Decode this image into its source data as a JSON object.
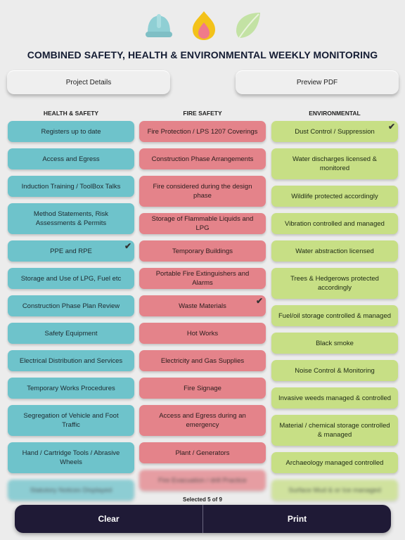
{
  "header": {
    "title": "COMBINED SAFETY, HEALTH & ENVIRONMENTAL WEEKLY MONITORING",
    "icons": [
      "hard-hat-icon",
      "flame-icon",
      "leaf-icon"
    ]
  },
  "top_buttons": {
    "project_details": "Project Details",
    "preview_pdf": "Preview PDF"
  },
  "columns": {
    "health_safety": {
      "heading": "HEALTH & SAFETY",
      "color": "#6ec3cb",
      "items": [
        {
          "label": "Registers up to date",
          "checked": false
        },
        {
          "label": "Access and Egress",
          "checked": false
        },
        {
          "label": "Induction Training / ToolBox Talks",
          "checked": false
        },
        {
          "label": "Method Statements, Risk Assessments & Permits",
          "checked": false
        },
        {
          "label": "PPE and RPE",
          "checked": true
        },
        {
          "label": "Storage and Use of LPG, Fuel etc",
          "checked": false
        },
        {
          "label": "Construction Phase Plan Review",
          "checked": false
        },
        {
          "label": "Safety Equipment",
          "checked": false
        },
        {
          "label": "Electrical Distribution and Services",
          "checked": false
        },
        {
          "label": "Temporary Works Procedures",
          "checked": false
        },
        {
          "label": "Segregation of Vehicle and Foot Traffic",
          "checked": false
        },
        {
          "label": "Hand / Cartridge Tools / Abrasive Wheels",
          "checked": false
        },
        {
          "label": "Statutory Notices Displayed",
          "checked": false
        }
      ]
    },
    "fire_safety": {
      "heading": "FIRE SAFETY",
      "color": "#e4838a",
      "items": [
        {
          "label": "Fire Protection / LPS 1207 Coverings",
          "checked": false
        },
        {
          "label": "Construction Phase Arrangements",
          "checked": false
        },
        {
          "label": "Fire considered during the design phase",
          "checked": false
        },
        {
          "label": "Storage of Flammable Liquids and LPG",
          "checked": false
        },
        {
          "label": "Temporary Buildings",
          "checked": false
        },
        {
          "label": "Portable Fire Extinguishers and Alarms",
          "checked": false
        },
        {
          "label": "Waste Materials",
          "checked": true
        },
        {
          "label": "Hot Works",
          "checked": false
        },
        {
          "label": "Electricity and Gas Supplies",
          "checked": false
        },
        {
          "label": "Fire Signage",
          "checked": false
        },
        {
          "label": "Access and Egress during an emergency",
          "checked": false
        },
        {
          "label": "Plant / Generators",
          "checked": false
        },
        {
          "label": "Fire Evacuation / drill Practice",
          "checked": false
        }
      ]
    },
    "environmental": {
      "heading": "ENVIRONMENTAL",
      "color": "#c7df85",
      "items": [
        {
          "label": "Dust Control / Suppression",
          "checked": true
        },
        {
          "label": "Water discharges licensed & monitored",
          "checked": false
        },
        {
          "label": "Wildlife protected accordingly",
          "checked": false
        },
        {
          "label": "Vibration controlled and managed",
          "checked": false
        },
        {
          "label": "Water abstraction licensed",
          "checked": false
        },
        {
          "label": "Trees & Hedgerows protected accordingly",
          "checked": false
        },
        {
          "label": "Fuel/oil storage controlled & managed",
          "checked": false
        },
        {
          "label": "Black smoke",
          "checked": false
        },
        {
          "label": "Noise Control & Monitoring",
          "checked": false
        },
        {
          "label": "Invasive weeds managed & controlled",
          "checked": false
        },
        {
          "label": "Material / chemical storage controlled & managed",
          "checked": false
        },
        {
          "label": "Archaeology managed controlled",
          "checked": false
        },
        {
          "label": "Surface Mud & or Ice managed",
          "checked": false
        }
      ]
    }
  },
  "footer": {
    "status": "Selected 5 of 9",
    "clear_label": "Clear",
    "print_label": "Print"
  }
}
